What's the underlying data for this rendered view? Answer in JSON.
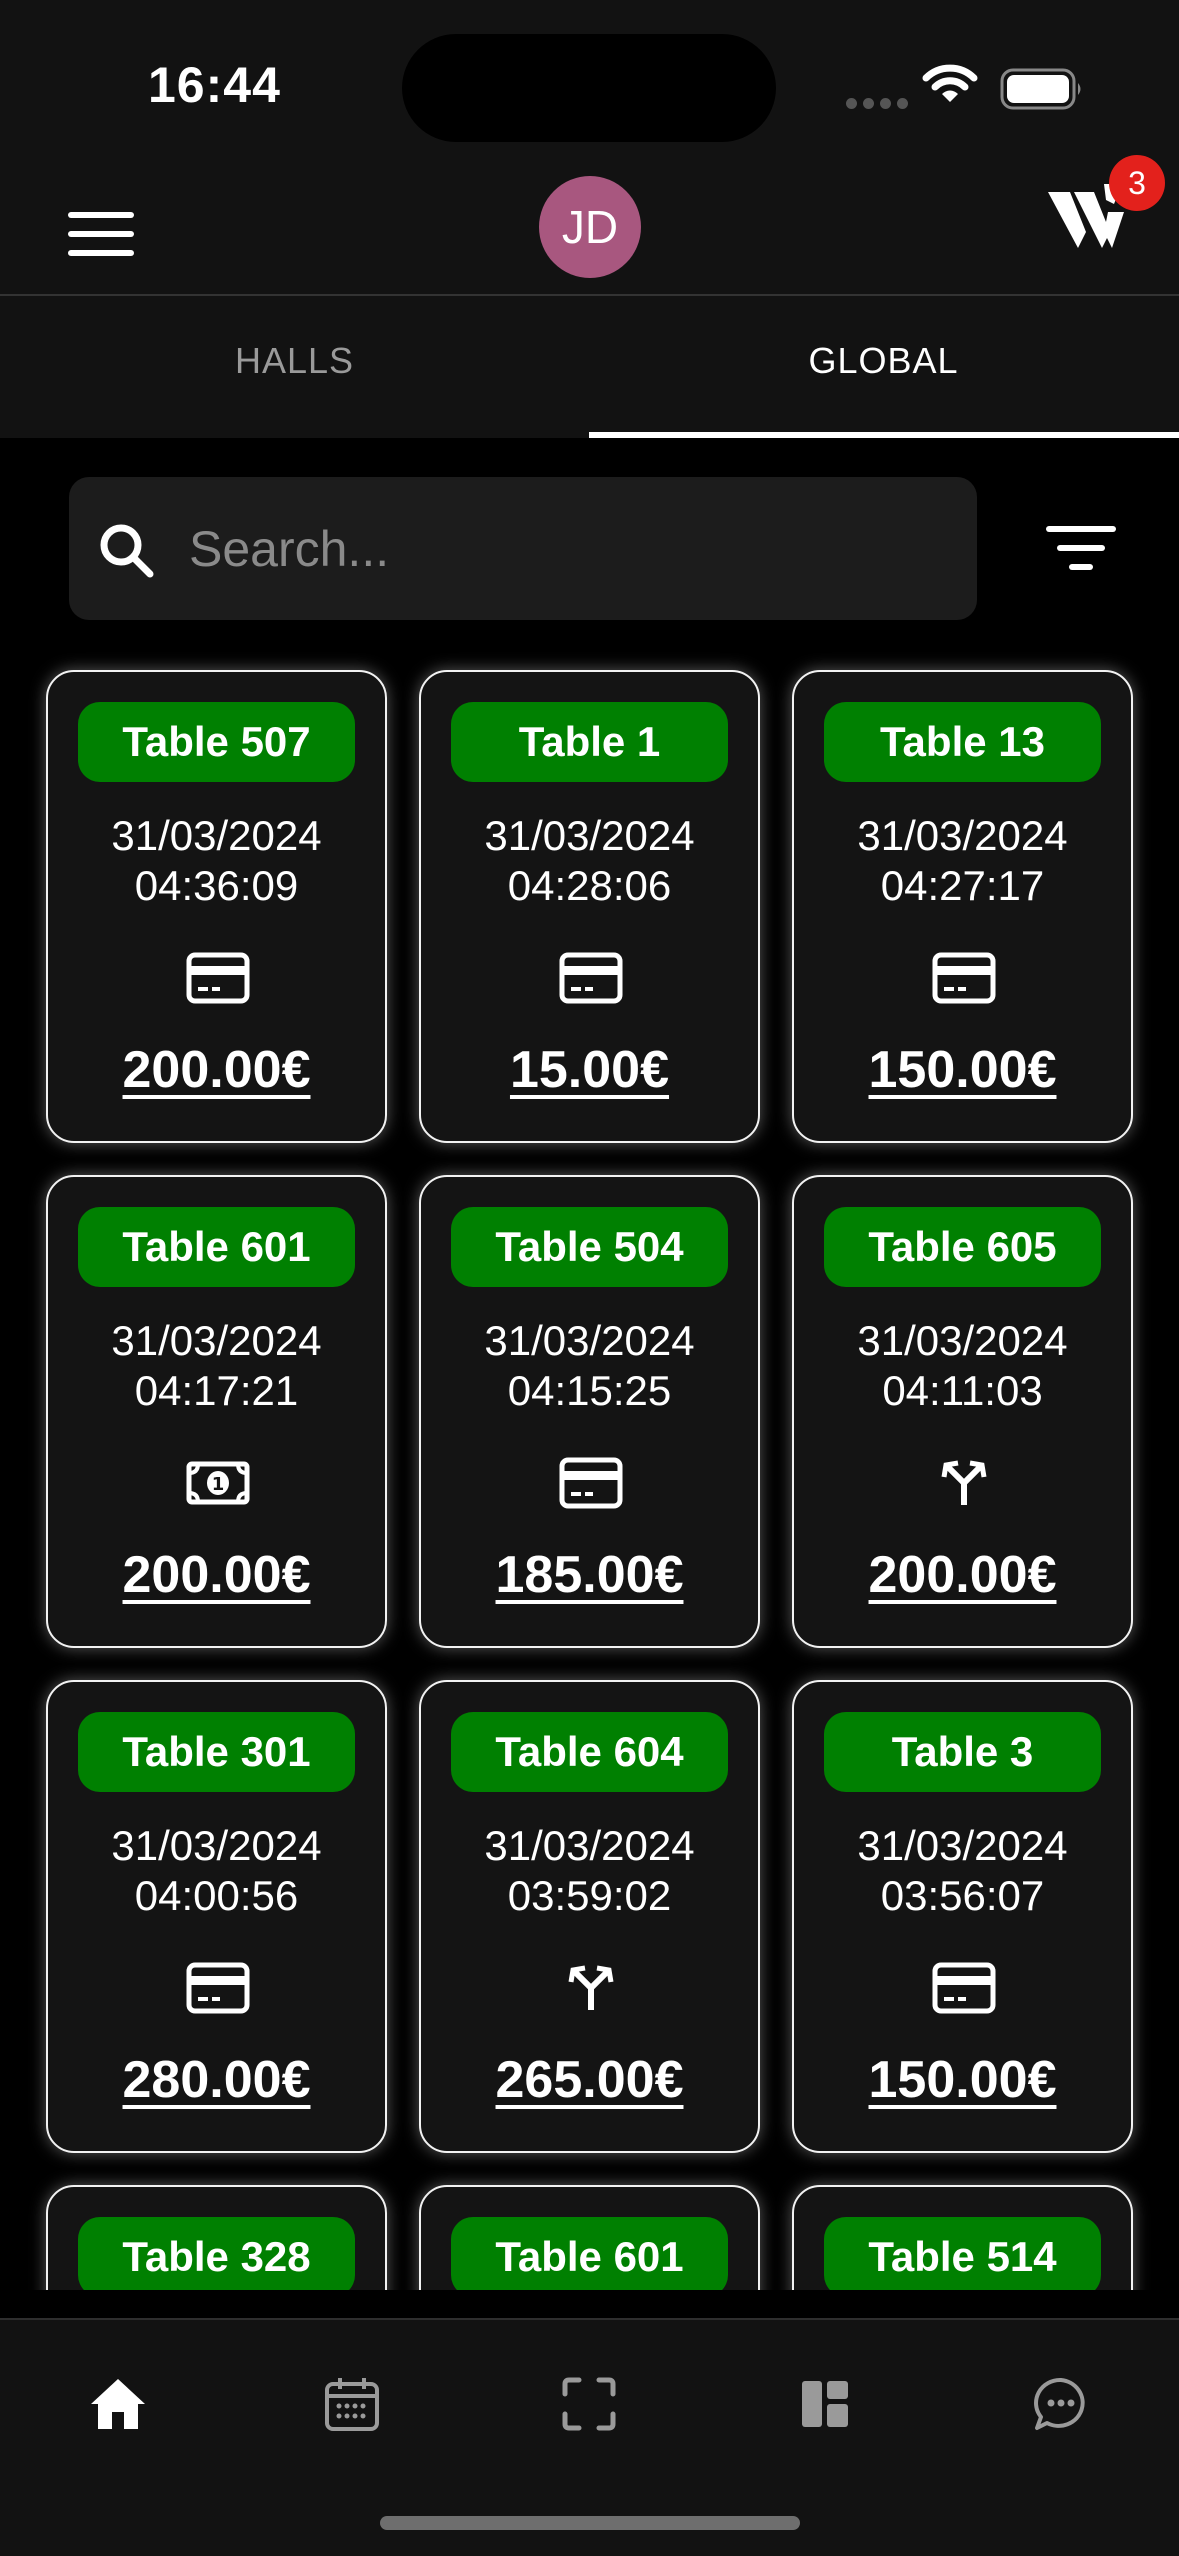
{
  "status_bar": {
    "time": "16:44"
  },
  "header": {
    "avatar_initials": "JD",
    "notification_count": "3"
  },
  "tabs": [
    {
      "label": "HALLS",
      "active": false
    },
    {
      "label": "GLOBAL",
      "active": true
    }
  ],
  "search": {
    "placeholder": "Search..."
  },
  "cards": [
    {
      "table": "Table 507",
      "date": "31/03/2024",
      "time": "04:36:09",
      "method": "card-icon",
      "amount": "200.00€"
    },
    {
      "table": "Table 1",
      "date": "31/03/2024",
      "time": "04:28:06",
      "method": "card-icon",
      "amount": "15.00€"
    },
    {
      "table": "Table 13",
      "date": "31/03/2024",
      "time": "04:27:17",
      "method": "card-icon",
      "amount": "150.00€"
    },
    {
      "table": "Table 601",
      "date": "31/03/2024",
      "time": "04:17:21",
      "method": "cash-icon",
      "amount": "200.00€"
    },
    {
      "table": "Table 504",
      "date": "31/03/2024",
      "time": "04:15:25",
      "method": "card-icon",
      "amount": "185.00€"
    },
    {
      "table": "Table 605",
      "date": "31/03/2024",
      "time": "04:11:03",
      "method": "split-icon",
      "amount": "200.00€"
    },
    {
      "table": "Table 301",
      "date": "31/03/2024",
      "time": "04:00:56",
      "method": "card-icon",
      "amount": "280.00€"
    },
    {
      "table": "Table 604",
      "date": "31/03/2024",
      "time": "03:59:02",
      "method": "split-icon",
      "amount": "265.00€"
    },
    {
      "table": "Table 3",
      "date": "31/03/2024",
      "time": "03:56:07",
      "method": "card-icon",
      "amount": "150.00€"
    },
    {
      "table": "Table 328",
      "date": "",
      "time": "",
      "method": "",
      "amount": ""
    },
    {
      "table": "Table 601",
      "date": "",
      "time": "",
      "method": "",
      "amount": ""
    },
    {
      "table": "Table 514",
      "date": "",
      "time": "",
      "method": "",
      "amount": ""
    }
  ],
  "bottom_nav": [
    {
      "icon": "home-icon",
      "active": true
    },
    {
      "icon": "calendar-icon",
      "active": false
    },
    {
      "icon": "scan-icon",
      "active": false
    },
    {
      "icon": "dashboard-icon",
      "active": false
    },
    {
      "icon": "chat-icon",
      "active": false
    }
  ],
  "colors": {
    "badge_green": "#008001",
    "avatar": "#a8577f",
    "notification": "#e3211c"
  }
}
